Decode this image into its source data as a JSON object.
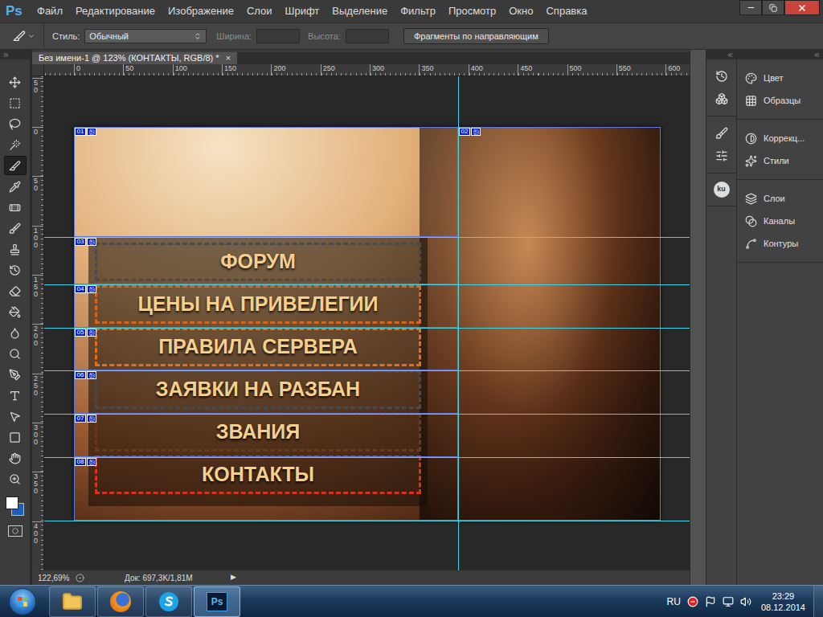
{
  "app": {
    "logo": "Ps"
  },
  "menu": [
    "Файл",
    "Редактирование",
    "Изображение",
    "Слои",
    "Шрифт",
    "Выделение",
    "Фильтр",
    "Просмотр",
    "Окно",
    "Справка"
  ],
  "options_bar": {
    "style_label": "Стиль:",
    "style_value": "Обычный",
    "width_label": "Ширина:",
    "width_disabled": true,
    "height_label": "Высота:",
    "height_disabled": true,
    "guides_button": "Фрагменты по направляющим"
  },
  "tools": [
    {
      "selected": false
    },
    {
      "selected": false
    },
    {
      "selected": false
    },
    {
      "selected": false
    },
    {
      "selected": true
    },
    {
      "selected": false
    },
    {
      "selected": false
    },
    {
      "selected": false
    },
    {
      "selected": false
    },
    {
      "selected": false
    },
    {
      "selected": false
    },
    {
      "selected": false
    },
    {
      "selected": false
    },
    {
      "selected": false
    },
    {
      "selected": false
    },
    {
      "selected": false
    },
    {
      "selected": false
    },
    {
      "selected": false
    },
    {
      "selected": false
    },
    {
      "selected": false
    }
  ],
  "colors": {
    "foreground": "#ffffff",
    "background": "#1c5fb8"
  },
  "document": {
    "tab": {
      "title": "Без имени-1 @ 123% (КОНТАКТЫ, RGB/8) *",
      "close": "×",
      "selected": true
    },
    "ruler_h": [
      "0",
      "50",
      "100",
      "150",
      "200",
      "250",
      "300",
      "350",
      "400",
      "450",
      "500",
      "550",
      "600"
    ],
    "ruler_v": [
      "50",
      "0",
      "50",
      "100",
      "150",
      "200",
      "250",
      "300",
      "350",
      "400"
    ],
    "slices": [
      "01",
      "02",
      "03",
      "04",
      "05",
      "06",
      "07",
      "08"
    ],
    "menu_buttons": [
      {
        "label": "ФОРУМ",
        "color": "#4a4a4a"
      },
      {
        "label": "ЦЕНЫ НА ПРИВЕЛЕГИИ",
        "color": "#d9641c"
      },
      {
        "label": "ПРАВИЛА СЕРВЕРА",
        "color": "#e0701c"
      },
      {
        "label": "ЗАЯВКИ НА РАЗБАН",
        "color": "#4a4a4a"
      },
      {
        "label": "ЗВАНИЯ",
        "color": "#6b3a1a"
      },
      {
        "label": "КОНТАКТЫ",
        "color": "#d8321a"
      }
    ]
  },
  "status_bar": {
    "zoom": "122,69%",
    "doc_size": "Док: 697,3K/1,81M",
    "menu_arrow": "▶"
  },
  "dock": {
    "badge": "ku"
  },
  "panels": [
    [
      {
        "label": "Цвет"
      },
      {
        "label": "Образцы"
      }
    ],
    [
      {
        "label": "Коррекц..."
      },
      {
        "label": "Стили"
      }
    ],
    [
      {
        "label": "Слои"
      },
      {
        "label": "Каналы"
      },
      {
        "label": "Контуры"
      }
    ]
  ],
  "taskbar": {
    "apps": [
      {
        "selected": false,
        "label": ""
      },
      {
        "selected": false,
        "label": ""
      },
      {
        "selected": false,
        "label": ""
      },
      {
        "selected": true,
        "label": "Ps"
      }
    ],
    "language": "RU",
    "time": "23:29",
    "date": "08.12.2014"
  }
}
